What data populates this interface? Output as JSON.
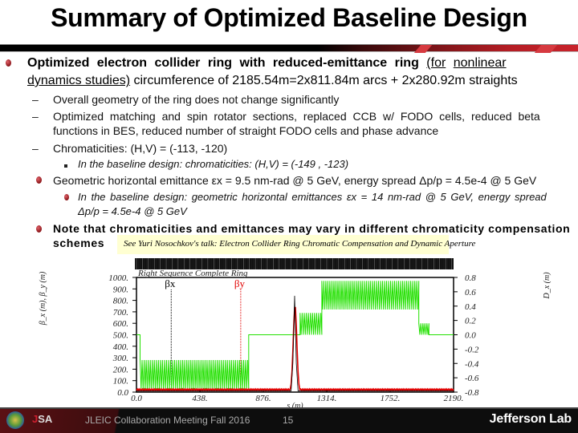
{
  "slide": {
    "title": "Summary of Optimized Baseline Design",
    "bullets": {
      "b1_line1_pre": "Optimized electron collider ring with reduced-emittance ring ",
      "b1_link1": "(for",
      "b1_link2": "nonlinear",
      "b1_link3": "dynamics studies)",
      "b1_line2_post": " circumference of 2185.54m=2x811.84m arcs + 2x280.92m straights",
      "sub1": "Overall geometry of the ring does not change significantly",
      "sub2_line1": "Optimized matching and spin rotator sections, replaced CCB w/ FODO cells, reduced beta",
      "sub2_line2": "functions in BES, reduced number of  straight FODO cells and phase advance",
      "sub3": "Chromaticities: (H,V) = (-113, -120)",
      "sub3_detail": "In the baseline design: chromaticities: (H,V) = (-149 , -123)",
      "b2": "Geometric horizontal emittance εx = 9.5 nm-rad @ 5 GeV, energy spread Δp/p = 4.5e-4 @ 5 GeV",
      "b2_detail_line1": "In the baseline design: geometric horizontal emittances εx = 14 nm-rad @ 5 GeV, energy spread",
      "b2_detail_line2": "Δp/p = 4.5e-4 @ 5 GeV",
      "b3_line1": "Note that chromaticities and emittances may vary in different chromaticity compensation",
      "b3_line2": "schemes"
    },
    "note": "See Yuri Nosochkov's talk: Electron Collider Ring Chromatic Compensation and Dynamic Aperture"
  },
  "chart_data": {
    "type": "line",
    "title": "Right Sequence Complete Ring",
    "xlabel": "s (m)",
    "ylabel_left": "β_x (m), β_y (m)",
    "ylabel_right": "D_x (m)",
    "x_ticks": [
      "0.0",
      "438.",
      "876.",
      "1314.",
      "1752.",
      "2190."
    ],
    "y_left_ticks": [
      "0.0",
      "100.",
      "200.",
      "300.",
      "400.",
      "500.",
      "600.",
      "700.",
      "800.",
      "900.",
      "1000."
    ],
    "y_right_ticks": [
      "-0.8",
      "-0.6",
      "-0.4",
      "-0.2",
      "0.0",
      "0.2",
      "0.4",
      "0.6",
      "0.8"
    ],
    "xlim": [
      0,
      2190
    ],
    "ylim_left": [
      0,
      1000
    ],
    "ylim_right": [
      -0.8,
      0.8
    ],
    "legend": [
      {
        "name": "βx",
        "color": "#000000",
        "x_pos": 240
      },
      {
        "name": "βy",
        "color": "#e00000",
        "x_pos": 720
      }
    ],
    "series": [
      {
        "name": "Dx",
        "color": "#22e000",
        "envelope": [
          {
            "x0": 0,
            "x1": 25,
            "lo": 500,
            "hi": 500
          },
          {
            "x0": 25,
            "x1": 775,
            "lo": 20,
            "hi": 280
          },
          {
            "x0": 775,
            "x1": 1130,
            "lo": 500,
            "hi": 500
          },
          {
            "x0": 1130,
            "x1": 1280,
            "lo": 500,
            "hi": 690
          },
          {
            "x0": 1280,
            "x1": 1950,
            "lo": 720,
            "hi": 970
          },
          {
            "x0": 1950,
            "x1": 2020,
            "lo": 500,
            "hi": 600
          },
          {
            "x0": 2020,
            "x1": 2190,
            "lo": 500,
            "hi": 500
          }
        ]
      },
      {
        "name": "βy",
        "color": "#e00000",
        "baseline": 15,
        "peak_x": 1095,
        "peak_y": 760
      },
      {
        "name": "βx",
        "color": "#000000",
        "baseline": 10,
        "peak_x": 1092,
        "peak_y": 840
      }
    ]
  },
  "footer": {
    "meeting": "JLEIC Collaboration Meeting Fall 2016",
    "page": "15",
    "lab": "Jefferson Lab",
    "jsa_j": "J",
    "jsa_sa": "SA"
  }
}
